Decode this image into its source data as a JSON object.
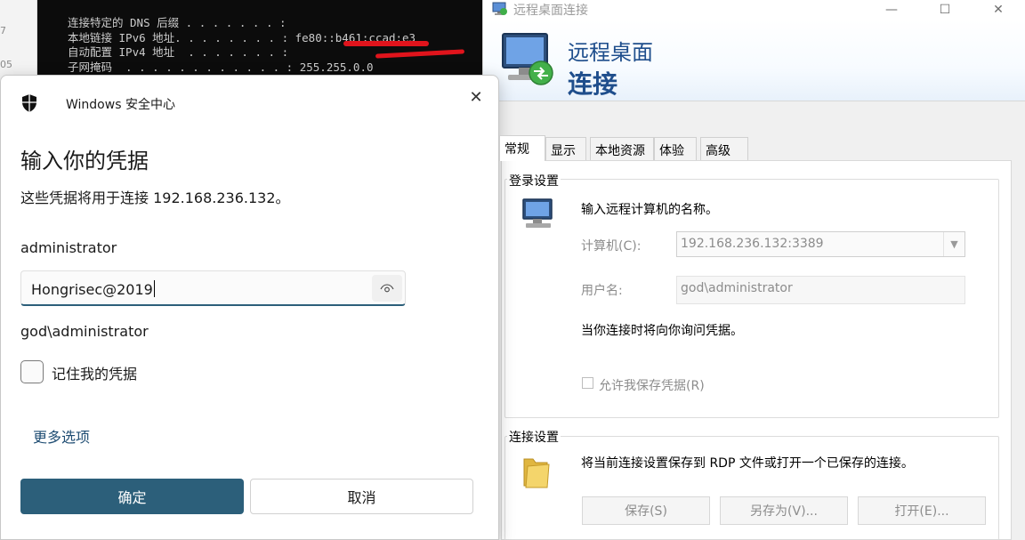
{
  "background": {
    "left_strip": [
      "7",
      "05"
    ],
    "terminal_lines": [
      "连接特定的 DNS 后缀 . . . . . . . :",
      "本地链接 IPv6 地址. . . . . . . . : fe80::b461:ccad:e3",
      "自动配置 IPv4 地址  . . . . . . . :",
      "子网掩码  . . . . . . . . . . . . : 255.255.0.0"
    ]
  },
  "rdp": {
    "title": "远程桌面连接",
    "window_buttons": {
      "minimize": "—",
      "maximize": "☐",
      "close": "✕"
    },
    "banner": {
      "line1": "远程桌面",
      "line2": "连接"
    },
    "tabs": [
      "常规",
      "显示",
      "本地资源",
      "体验",
      "高级"
    ],
    "login": {
      "title": "登录设置",
      "instruction": "输入远程计算机的名称。",
      "computer_label": "计算机(C):",
      "computer_value": "192.168.236.132:3389",
      "user_label": "用户名:",
      "user_value": "god\\administrator",
      "note": "当你连接时将向你询问凭据。",
      "save_cred_label": "允许我保存凭据(R)"
    },
    "connection": {
      "title": "连接设置",
      "instruction": "将当前连接设置保存到 RDP 文件或打开一个已保存的连接。",
      "buttons": [
        "保存(S)",
        "另存为(V)...",
        "打开(E)..."
      ]
    }
  },
  "dialog": {
    "app_name": "Windows 安全中心",
    "close_symbol": "✕",
    "heading": "输入你的凭据",
    "subtitle": "这些凭据将用于连接 192.168.236.132。",
    "username": "administrator",
    "password_value": "Hongrisec@2019",
    "domain_user": "god\\administrator",
    "remember_label": "记住我的凭据",
    "remember_checked": false,
    "more_options": "更多选项",
    "ok_label": "确定",
    "cancel_label": "取消"
  },
  "colors": {
    "accent": "#2c5f7a",
    "link": "#1f4d73",
    "banner_text": "#1f4e8c",
    "redaction": "#e0141c"
  }
}
